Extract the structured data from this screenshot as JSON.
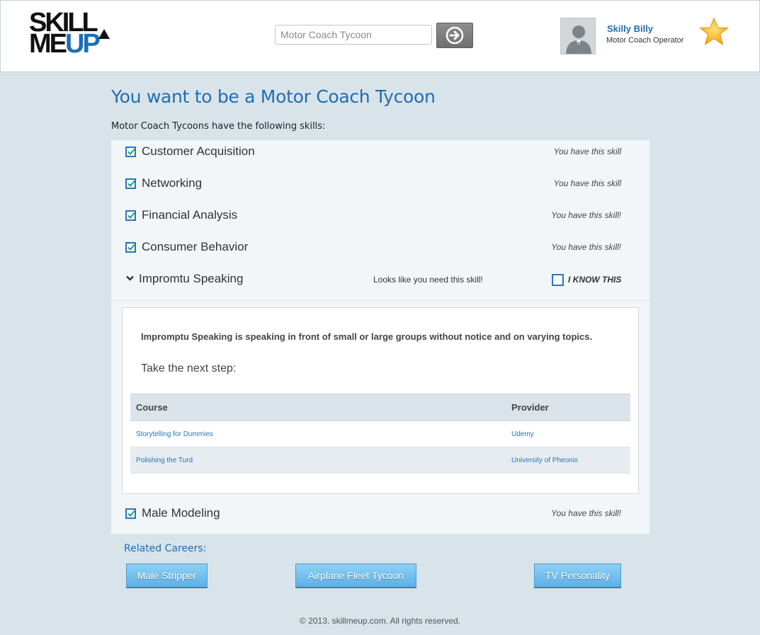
{
  "header": {
    "logo_line1": "SKILL",
    "logo_line2_a": "ME",
    "logo_line2_b": "UP",
    "search_placeholder": "Motor Coach Tycoon",
    "user_name": "Skilly Billy",
    "user_title": "Motor Coach Operator"
  },
  "main": {
    "title": "You want to be a Motor Coach Tycoon",
    "intro": "Motor Coach Tycoons have the following skills:"
  },
  "skills": [
    {
      "name": "Customer Acquisition",
      "status": "You have this skill"
    },
    {
      "name": "Networking",
      "status": "You have this skill"
    },
    {
      "name": "Financial Analysis",
      "status": "You have this skill!"
    },
    {
      "name": "Consumer Behavior",
      "status": "You have this skill!"
    }
  ],
  "expanded_skill": {
    "name": "Impromtu Speaking",
    "need_text": "Looks like you need this skill!",
    "know_label": "I KNOW THIS",
    "description": "Impromptu Speaking is speaking in front of small or large groups without notice and on varying topics.",
    "next_step": "Take the next step:",
    "table": {
      "headers": [
        "Course",
        "Provider"
      ],
      "rows": [
        {
          "course": "Storytelling for Dummies",
          "provider": "Udemy"
        },
        {
          "course": "Polishing the Turd",
          "provider": "University of Pheonix"
        }
      ]
    }
  },
  "last_skill": {
    "name": "Male Modeling",
    "status": "You have this skill!"
  },
  "related": {
    "label": "Related Careers:",
    "careers": [
      "Male Stripper",
      "Airplane Fleet Tycoon",
      "TV Personality"
    ]
  },
  "footer": "© 2013. skillmeup.com. All rights reserved.",
  "colors": {
    "accent": "#1f6eb2",
    "check": "#2a9d5c",
    "button": "#5cb1e6"
  }
}
